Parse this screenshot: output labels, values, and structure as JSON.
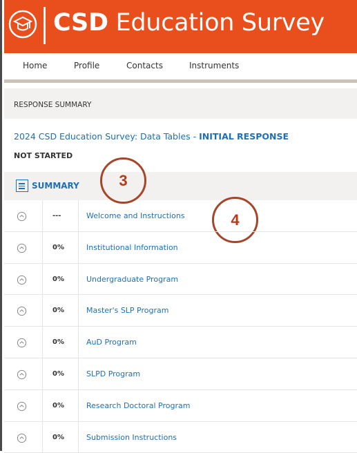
{
  "header": {
    "title_bold": "CSD",
    "title_rest": " Education Survey",
    "brand_color": "#e84f1c",
    "logo_icon": "graduation-cap-icon"
  },
  "nav": {
    "items": [
      {
        "label": "Home"
      },
      {
        "label": "Profile"
      },
      {
        "label": "Contacts"
      },
      {
        "label": "Instruments"
      }
    ]
  },
  "response": {
    "section_label": "RESPONSE SUMMARY",
    "survey_title": "2024 CSD Education Survey: Data Tables - ",
    "response_type": "INITIAL RESPONSE",
    "status": "NOT STARTED"
  },
  "summary": {
    "label": "SUMMARY",
    "icon": "list-icon"
  },
  "callouts": [
    "3",
    "4"
  ],
  "sections": [
    {
      "icon": "clock-icon",
      "progress": "---",
      "name": "Welcome and Instructions"
    },
    {
      "icon": "clock-icon",
      "progress": "0%",
      "name": "Institutional Information"
    },
    {
      "icon": "clock-icon",
      "progress": "0%",
      "name": "Undergraduate Program"
    },
    {
      "icon": "clock-icon",
      "progress": "0%",
      "name": "Master's SLP Program"
    },
    {
      "icon": "clock-icon",
      "progress": "0%",
      "name": "AuD Program"
    },
    {
      "icon": "clock-icon",
      "progress": "0%",
      "name": "SLPD Program"
    },
    {
      "icon": "clock-icon",
      "progress": "0%",
      "name": "Research Doctoral Program"
    },
    {
      "icon": "clock-icon",
      "progress": "0%",
      "name": "Submission Instructions"
    }
  ],
  "colors": {
    "link": "#1f6fb5",
    "callout": "#b23b1b",
    "panel_bg": "#f2f1ef"
  }
}
